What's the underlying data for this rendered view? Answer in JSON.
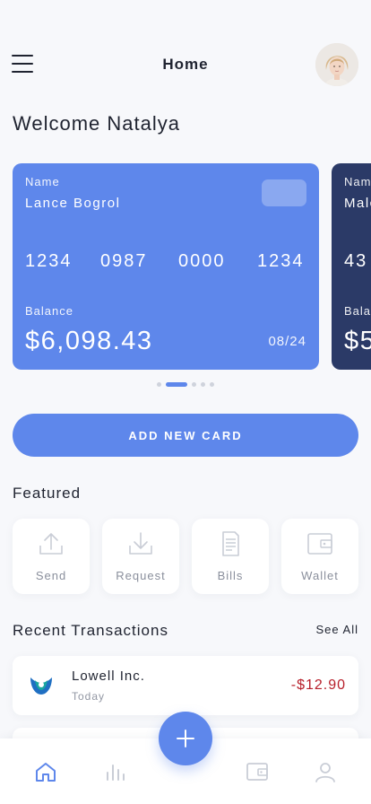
{
  "header": {
    "title": "Home",
    "menu_icon": "hamburger-menu-icon",
    "avatar": "user-avatar"
  },
  "welcome": "Welcome Natalya",
  "cards": [
    {
      "name_label": "Name",
      "name": "Lance Bogrol",
      "number_groups": [
        "1234",
        "0987",
        "0000",
        "1234"
      ],
      "balance_label": "Balance",
      "balance": "$6,098.43",
      "expiry": "08/24",
      "color": "#5e87eb"
    },
    {
      "name_label": "Nam",
      "name": "Malc",
      "number_groups": [
        "43"
      ],
      "balance_label": "Bala",
      "balance": "$5",
      "color": "#2b3a67"
    }
  ],
  "pager": {
    "count": 5,
    "active": 1
  },
  "add_card_label": "ADD NEW CARD",
  "featured": {
    "title": "Featured",
    "items": [
      {
        "label": "Send",
        "icon": "upload-icon"
      },
      {
        "label": "Request",
        "icon": "download-icon"
      },
      {
        "label": "Bills",
        "icon": "receipt-icon"
      },
      {
        "label": "Wallet",
        "icon": "wallet-icon"
      }
    ]
  },
  "recent": {
    "title": "Recent Transactions",
    "see_all": "See All",
    "items": [
      {
        "name": "Lowell Inc.",
        "date": "Today",
        "amount": "-$12.90",
        "icon": "company-logo-icon"
      }
    ]
  },
  "bottom_nav": {
    "items": [
      {
        "icon": "home-icon",
        "active": true
      },
      {
        "icon": "bar-chart-icon",
        "active": false
      },
      {
        "icon": "wallet-icon",
        "active": false
      },
      {
        "icon": "profile-icon",
        "active": false
      }
    ],
    "fab_icon": "plus-icon"
  },
  "colors": {
    "accent": "#5e87eb",
    "card_dark": "#2b3a67",
    "negative": "#b71f2a",
    "muted": "#8a8f9c"
  }
}
